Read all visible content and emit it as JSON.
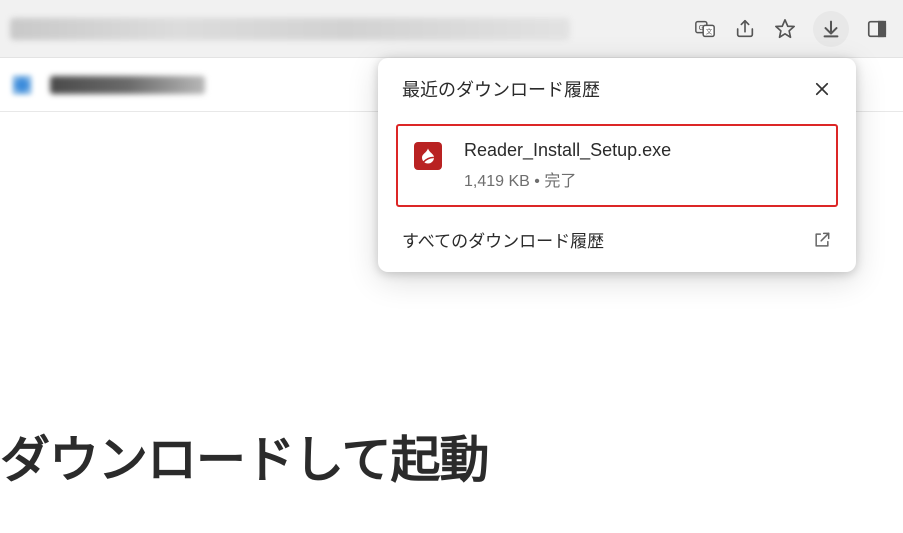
{
  "downloads_popup": {
    "title": "最近のダウンロード履歴",
    "item": {
      "filename": "Reader_Install_Setup.exe",
      "size": "1,419 KB",
      "separator": " • ",
      "status": "完了"
    },
    "footer_label": "すべてのダウンロード履歴"
  },
  "page": {
    "headline": "ダウンロードして起動"
  }
}
